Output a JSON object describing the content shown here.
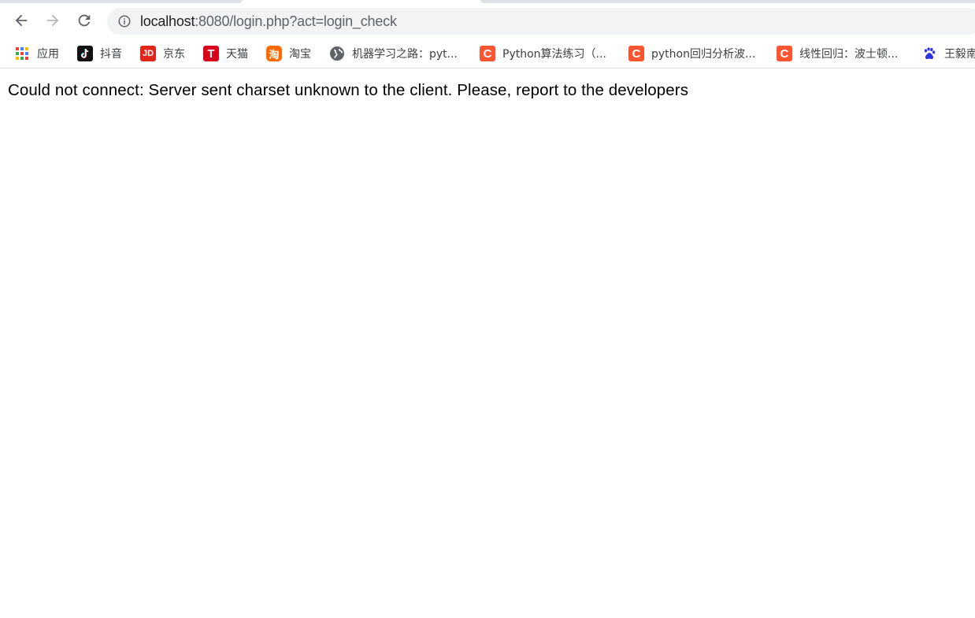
{
  "browser": {
    "address_bar": {
      "host": "localhost",
      "rest": ":8080/login.php?act=login_check"
    },
    "nav": {
      "back_icon": "arrow-left-icon",
      "forward_icon": "arrow-right-icon",
      "reload_icon": "reload-icon",
      "info_icon": "info-circle-icon"
    },
    "bookmarks": [
      {
        "label": "应用",
        "icon": "apps-grid-icon"
      },
      {
        "label": "抖音",
        "icon": "douyin-icon"
      },
      {
        "label": "京东",
        "icon": "jd-icon",
        "icon_text": "JD",
        "color": "#e1251b"
      },
      {
        "label": "天猫",
        "icon": "tmall-icon",
        "icon_text": "T",
        "color": "#d9001b"
      },
      {
        "label": "淘宝",
        "icon": "taobao-icon",
        "icon_text": "淘",
        "color": "#ff6a00"
      },
      {
        "label": "机器学习之路：pyt...",
        "icon": "globe-icon"
      },
      {
        "label": "Python算法练习（...",
        "icon": "csdn-icon",
        "icon_text": "C",
        "color": "#fc5531"
      },
      {
        "label": "python回归分析波...",
        "icon": "csdn-icon",
        "icon_text": "C",
        "color": "#fc5531"
      },
      {
        "label": "线性回归：波士顿...",
        "icon": "csdn-icon",
        "icon_text": "C",
        "color": "#fc5531"
      },
      {
        "label": "王毅南",
        "icon": "baidu-paw-icon",
        "color": "#2932e1"
      }
    ]
  },
  "page": {
    "error_message": "Could not connect: Server sent charset unknown to the client. Please, report to the developers"
  }
}
